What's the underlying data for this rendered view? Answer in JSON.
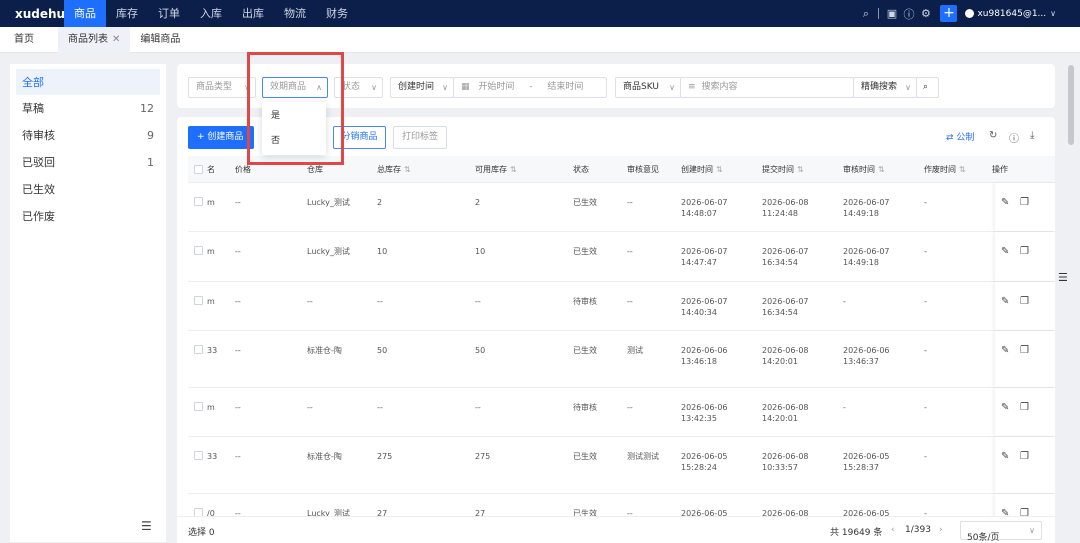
{
  "nav": {
    "brand": "xudehui",
    "items": [
      "商品",
      "库存",
      "订单",
      "入库",
      "出库",
      "物流",
      "财务"
    ],
    "user": "xu981645@1..."
  },
  "tabs": [
    "首页",
    "商品列表",
    "编辑商品"
  ],
  "sidebar": {
    "items": [
      {
        "label": "全部",
        "count": ""
      },
      {
        "label": "草稿",
        "count": "12"
      },
      {
        "label": "待审核",
        "count": "9"
      },
      {
        "label": "已驳回",
        "count": "1"
      },
      {
        "label": "已生效",
        "count": ""
      },
      {
        "label": "已作废",
        "count": ""
      }
    ]
  },
  "filters": {
    "product_type": "商品类型",
    "expiry_product": "效期商品",
    "status": "状态",
    "create_time": "创建时间",
    "start_time": "开始时间",
    "dash": "-",
    "end_time": "结束时间",
    "sku": "商品SKU",
    "search_placeholder": "搜索内容",
    "exact_search": "精确搜索"
  },
  "dropdown": {
    "options": [
      "是",
      "否"
    ]
  },
  "toolbar": {
    "create": "创建商品",
    "distribute": "分销商品",
    "print": "打印标签",
    "public": "公制"
  },
  "table": {
    "headers": [
      "名",
      "价格",
      "仓库",
      "总库存",
      "可用库存",
      "状态",
      "审核意见",
      "创建时间",
      "提交时间",
      "审核时间",
      "作废时间",
      "操作"
    ],
    "rows": [
      {
        "name": "m",
        "price": "--",
        "warehouse": "Lucky_测试",
        "total": "2",
        "available": "2",
        "status": "已生效",
        "review": "--",
        "created": [
          "2026-06-07",
          "14:48:07"
        ],
        "submitted": [
          "2026-06-08",
          "11:24:48"
        ],
        "reviewed": [
          "2026-06-07",
          "14:49:18"
        ],
        "voided": "-"
      },
      {
        "name": "m",
        "price": "--",
        "warehouse": "Lucky_测试",
        "total": "10",
        "available": "10",
        "status": "已生效",
        "review": "--",
        "created": [
          "2026-06-07",
          "14:47:47"
        ],
        "submitted": [
          "2026-06-07",
          "16:34:54"
        ],
        "reviewed": [
          "2026-06-07",
          "14:49:18"
        ],
        "voided": "-"
      },
      {
        "name": "m",
        "price": "--",
        "warehouse": "--",
        "total": "--",
        "available": "--",
        "status": "待审核",
        "review": "--",
        "created": [
          "2026-06-07",
          "14:40:34"
        ],
        "submitted": [
          "2026-06-07",
          "16:34:54"
        ],
        "reviewed": [
          "-",
          ""
        ],
        "voided": "-"
      },
      {
        "name": "33",
        "price": "--",
        "warehouse": "标准仓-陶",
        "total": "50",
        "available": "50",
        "status": "已生效",
        "review": "测试",
        "created": [
          "2026-06-06",
          "13:46:18"
        ],
        "submitted": [
          "2026-06-08",
          "14:20:01"
        ],
        "reviewed": [
          "2026-06-06",
          "13:46:37"
        ],
        "voided": "-"
      },
      {
        "name": "m",
        "price": "--",
        "warehouse": "--",
        "total": "--",
        "available": "--",
        "status": "待审核",
        "review": "--",
        "created": [
          "2026-06-06",
          "13:42:35"
        ],
        "submitted": [
          "2026-06-08",
          "14:20:01"
        ],
        "reviewed": [
          "-",
          ""
        ],
        "voided": "-"
      },
      {
        "name": "33",
        "price": "--",
        "warehouse": "标准仓-陶",
        "total": "275",
        "available": "275",
        "status": "已生效",
        "review": "测试测试",
        "created": [
          "2026-06-05",
          "15:28:24"
        ],
        "submitted": [
          "2026-06-08",
          "10:33:57"
        ],
        "reviewed": [
          "2026-06-05",
          "15:28:37"
        ],
        "voided": "-"
      },
      {
        "name": "/0",
        "price": "--",
        "warehouse": "Lucky_测试",
        "total": "27",
        "available": "27",
        "status": "已生效",
        "review": "--",
        "created": [
          "2026-06-05",
          ""
        ],
        "submitted": [
          "2026-06-08",
          ""
        ],
        "reviewed": [
          "2026-06-05",
          ""
        ],
        "voided": "-"
      }
    ]
  },
  "footer": {
    "selected": "选择 0",
    "total": "共 19649 条",
    "page": "1/393",
    "page_size": "50条/页"
  }
}
